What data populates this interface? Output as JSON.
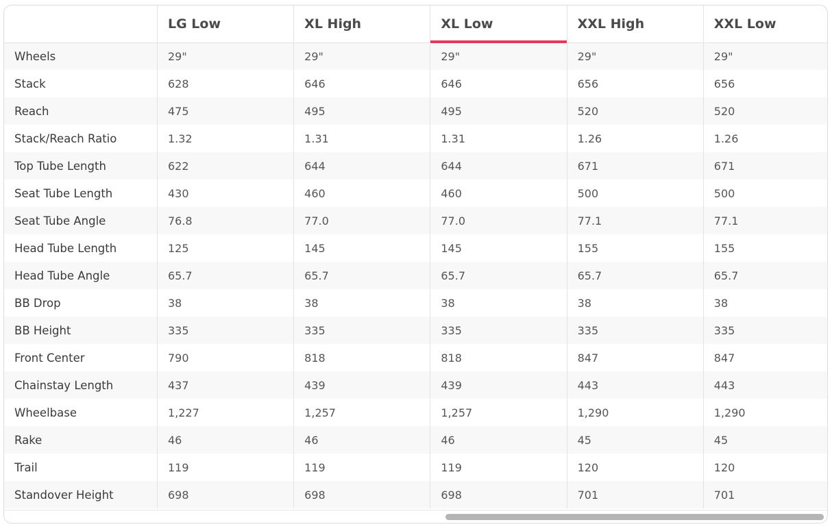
{
  "table": {
    "columns": [
      "",
      "LG Low",
      "XL High",
      "XL Low",
      "XXL High",
      "XXL Low"
    ],
    "active_column": "XL Low",
    "rows": [
      {
        "label": "Wheels",
        "values": [
          "29\"",
          "29\"",
          "29\"",
          "29\"",
          "29\""
        ]
      },
      {
        "label": "Stack",
        "values": [
          "628",
          "646",
          "646",
          "656",
          "656"
        ]
      },
      {
        "label": "Reach",
        "values": [
          "475",
          "495",
          "495",
          "520",
          "520"
        ]
      },
      {
        "label": "Stack/Reach Ratio",
        "values": [
          "1.32",
          "1.31",
          "1.31",
          "1.26",
          "1.26"
        ]
      },
      {
        "label": "Top Tube Length",
        "values": [
          "622",
          "644",
          "644",
          "671",
          "671"
        ]
      },
      {
        "label": "Seat Tube Length",
        "values": [
          "430",
          "460",
          "460",
          "500",
          "500"
        ]
      },
      {
        "label": "Seat Tube Angle",
        "values": [
          "76.8",
          "77.0",
          "77.0",
          "77.1",
          "77.1"
        ]
      },
      {
        "label": "Head Tube Length",
        "values": [
          "125",
          "145",
          "145",
          "155",
          "155"
        ]
      },
      {
        "label": "Head Tube Angle",
        "values": [
          "65.7",
          "65.7",
          "65.7",
          "65.7",
          "65.7"
        ]
      },
      {
        "label": "BB Drop",
        "values": [
          "38",
          "38",
          "38",
          "38",
          "38"
        ]
      },
      {
        "label": "BB Height",
        "values": [
          "335",
          "335",
          "335",
          "335",
          "335"
        ]
      },
      {
        "label": "Front Center",
        "values": [
          "790",
          "818",
          "818",
          "847",
          "847"
        ]
      },
      {
        "label": "Chainstay Length",
        "values": [
          "437",
          "439",
          "439",
          "443",
          "443"
        ]
      },
      {
        "label": "Wheelbase",
        "values": [
          "1,227",
          "1,257",
          "1,257",
          "1,290",
          "1,290"
        ]
      },
      {
        "label": "Rake",
        "values": [
          "46",
          "46",
          "46",
          "45",
          "45"
        ]
      },
      {
        "label": "Trail",
        "values": [
          "119",
          "119",
          "119",
          "120",
          "120"
        ]
      },
      {
        "label": "Standover Height",
        "values": [
          "698",
          "698",
          "698",
          "701",
          "701"
        ]
      }
    ]
  },
  "colors": {
    "accent": "#e8385a",
    "stripe": "#f8f8f8",
    "border": "#e3e3e3"
  }
}
